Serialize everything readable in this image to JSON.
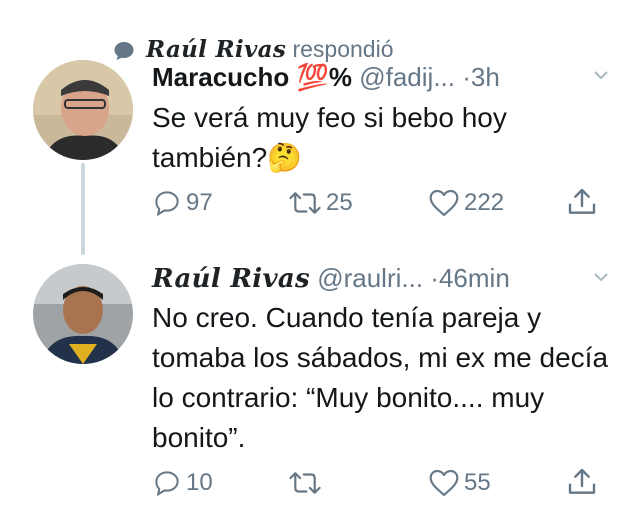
{
  "reply_context": {
    "name": "Raúl Rivas",
    "action": "respondió"
  },
  "tweet1": {
    "name": "Maracucho",
    "badge": "💯",
    "badge_suffix": "%",
    "handle": "@fadij...",
    "dot": "·",
    "time": "3h",
    "text": "Se verá muy feo si bebo hoy también?",
    "emoji": "🤔",
    "replies": "97",
    "retweets": "25",
    "likes": "222"
  },
  "tweet2": {
    "name": "Raúl Rivas",
    "handle": "@raulri...",
    "dot": "·",
    "time": "46min",
    "text": "No creo. Cuando tenía pareja y tomaba los sábados, mi ex me decía lo contrario: “Muy bonito.... muy bonito”.",
    "replies": "10",
    "retweets": "",
    "likes": "55"
  },
  "colors": {
    "text": "#14171a",
    "muted": "#657786",
    "line": "#ccd6dd"
  },
  "icons": [
    "speech-bubble-icon",
    "reply-icon",
    "retweet-icon",
    "like-icon",
    "share-icon",
    "chevron-down-icon"
  ]
}
